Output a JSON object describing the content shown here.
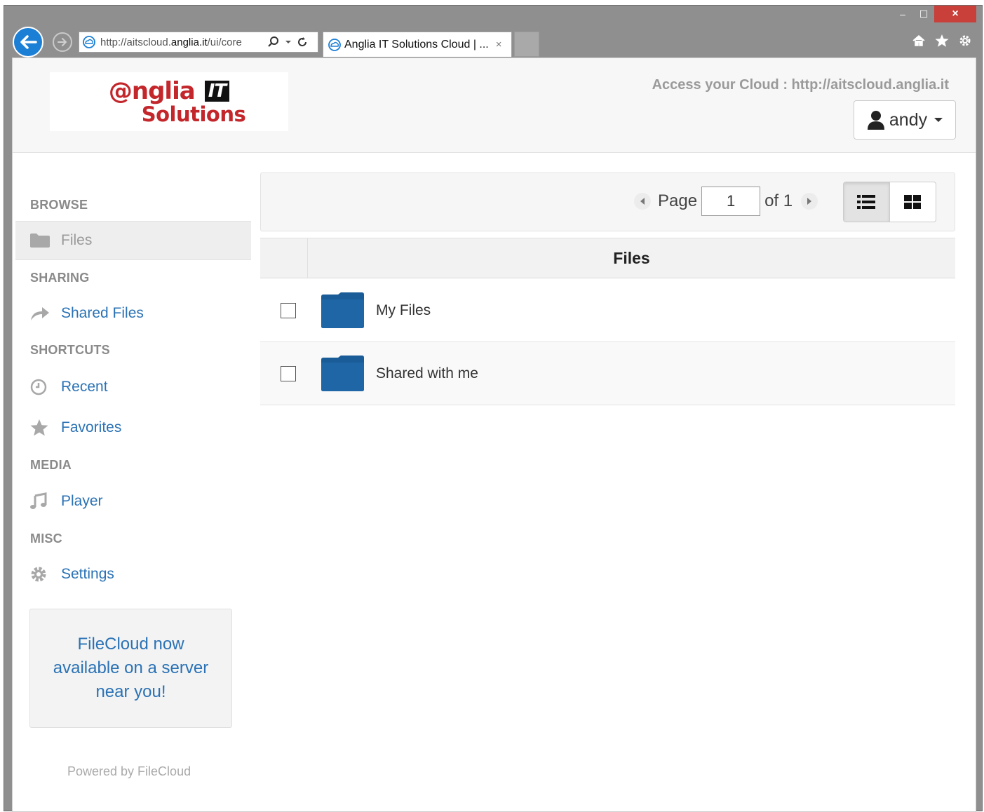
{
  "browser": {
    "url_prefix": "http://aitscloud.",
    "url_domain": "anglia.it",
    "url_suffix": "/ui/core",
    "tab_title": "Anglia IT Solutions Cloud | ...",
    "tab_close": "×",
    "window_minimize": "–",
    "window_maximize": "☐",
    "window_close": "×"
  },
  "header": {
    "logo_line1": "@nglia",
    "logo_it": "IT",
    "logo_line2": "Solutions",
    "access_text": "Access your Cloud : http://aitscloud.anglia.it",
    "user_name": "andy"
  },
  "sidebar": {
    "sections": {
      "browse": "BROWSE",
      "sharing": "SHARING",
      "shortcuts": "SHORTCUTS",
      "media": "MEDIA",
      "misc": "MISC"
    },
    "items": {
      "files": "Files",
      "shared_files": "Shared Files",
      "recent": "Recent",
      "favorites": "Favorites",
      "player": "Player",
      "settings": "Settings"
    },
    "promo": "FileCloud now available on a server near you!",
    "powered_by": "Powered by FileCloud"
  },
  "toolbar": {
    "page_label": "Page",
    "page_value": "1",
    "of_label": "of 1"
  },
  "table": {
    "header": "Files",
    "rows": [
      {
        "name": "My Files"
      },
      {
        "name": "Shared with me"
      }
    ]
  },
  "colors": {
    "link": "#2a72b5",
    "folder": "#1f5f99",
    "logo_red": "#c3262b",
    "ie_blue": "#1c7fd6"
  }
}
